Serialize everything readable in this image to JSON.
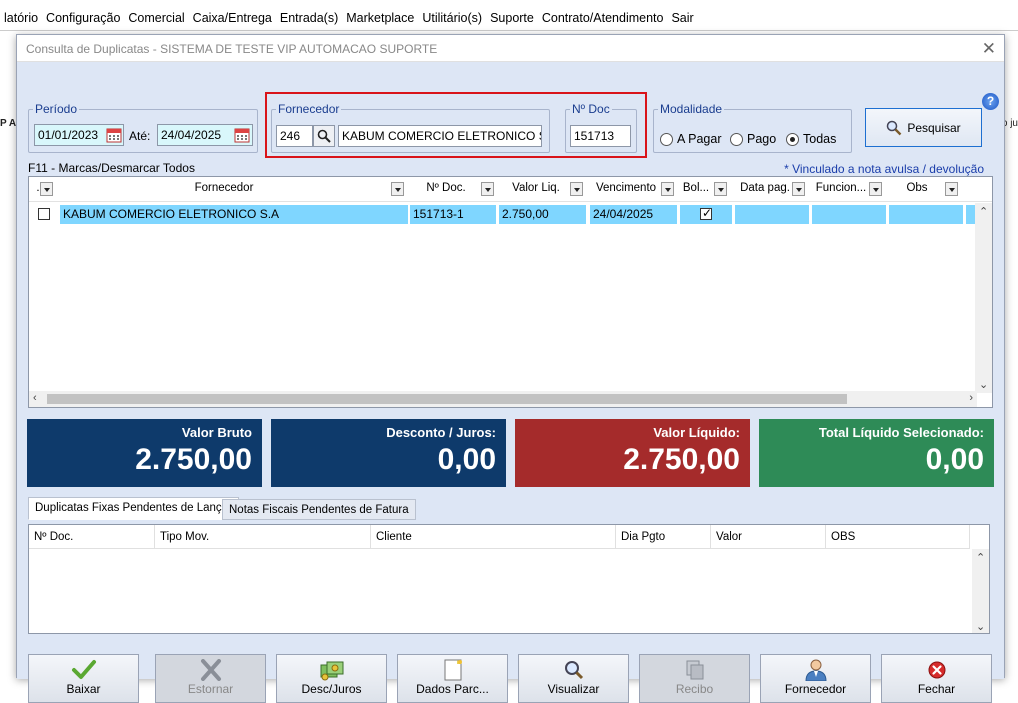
{
  "app": {
    "menubar": [
      "latório",
      "Configuração",
      "Comercial",
      "Caixa/Entrega",
      "Entrada(s)",
      "Marketplace",
      "Utilitário(s)",
      "Suporte",
      "Contrato/Atendimento",
      "Sair"
    ],
    "bg_left_text": "P AL",
    "bg_right_text": "o ju"
  },
  "dialog": {
    "title": "Consulta de Duplicatas - SISTEMA DE TESTE VIP AUTOMACAO SUPORTE",
    "close_glyph": "✕",
    "help_glyph": "?",
    "periodo": {
      "legend": "Período",
      "start": "01/01/2023",
      "until_label": "Até:",
      "end": "24/04/2025"
    },
    "fornecedor": {
      "legend": "Fornecedor",
      "code": "246",
      "name": "KABUM COMERCIO ELETRONICO S.A"
    },
    "ndoc": {
      "legend": "Nº Doc",
      "value": "151713"
    },
    "modalidade": {
      "legend": "Modalidade",
      "options": [
        "A Pagar",
        "Pago",
        "Todas"
      ],
      "selected": "Todas"
    },
    "search_button": "Pesquisar",
    "f11_hint": "F11 - Marcas/Desmarcar Todos",
    "vinculado_note": "* Vinculado a nota avulsa / devolução",
    "grid": {
      "columns": [
        ".",
        "Fornecedor",
        "Nº Doc.",
        "Valor Liq.",
        "Vencimento",
        "Bol...",
        "Data pag.",
        "Funcion...",
        "Obs"
      ],
      "rows": [
        {
          "checked": false,
          "fornecedor": "KABUM COMERCIO ELETRONICO S.A",
          "ndoc": "151713-1",
          "valor": "2.750,00",
          "vencimento": "24/04/2025",
          "boleto": true,
          "data_pag": "",
          "funcionario": "",
          "obs": ""
        }
      ]
    },
    "cards": [
      {
        "label": "Valor Bruto",
        "value": "2.750,00",
        "color": "#0e3a6b"
      },
      {
        "label": "Desconto / Juros:",
        "value": "0,00",
        "color": "#0e3a6b"
      },
      {
        "label": "Valor Líquido:",
        "value": "2.750,00",
        "color": "#a52b2b"
      },
      {
        "label": "Total Líquido Selecionado:",
        "value": "0,00",
        "color": "#2e8b57"
      }
    ],
    "tabs": [
      "Duplicatas Fixas Pendentes de Lançar",
      "Notas Fiscais Pendentes de Fatura"
    ],
    "active_tab": 0,
    "grid2": {
      "columns": [
        "Nº Doc.",
        "Tipo Mov.",
        "Cliente",
        "Dia Pgto",
        "Valor",
        "OBS"
      ]
    },
    "actions": [
      {
        "label": "Baixar",
        "icon": "check-icon",
        "enabled": true
      },
      {
        "label": "Estornar",
        "icon": "x-icon",
        "enabled": false
      },
      {
        "label": "Desc/Juros",
        "icon": "money-icon",
        "enabled": true
      },
      {
        "label": "Dados Parc...",
        "icon": "note-icon",
        "enabled": true
      },
      {
        "label": "Visualizar",
        "icon": "magnifier-icon",
        "enabled": true
      },
      {
        "label": "Recibo",
        "icon": "copy-icon",
        "enabled": false
      },
      {
        "label": "Fornecedor",
        "icon": "person-icon",
        "enabled": true
      },
      {
        "label": "Fechar",
        "icon": "close-circle-icon",
        "enabled": true
      }
    ]
  }
}
